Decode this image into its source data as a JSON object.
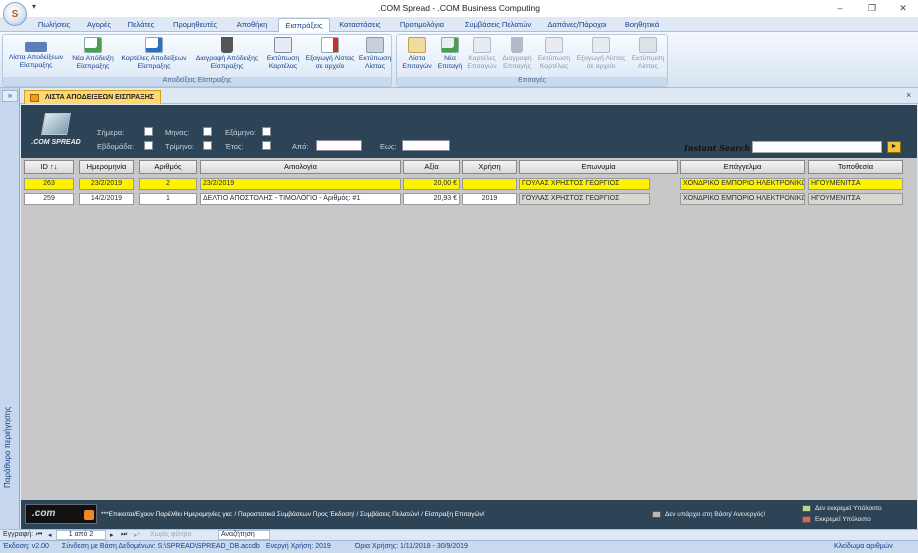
{
  "window": {
    "title": ".COM Spread - .COM Business Computing",
    "minimize": "–",
    "maximize": "❐",
    "close": "✕",
    "orb": "S",
    "qat": "▾"
  },
  "ribbon_tabs": [
    {
      "label": "Πωλήσεις"
    },
    {
      "label": "Αγορές"
    },
    {
      "label": "Πελάτες"
    },
    {
      "label": "Προμηθευτές"
    },
    {
      "label": "Αποθήκη"
    },
    {
      "label": "Εισπράξεις",
      "active": true
    },
    {
      "label": "Καταστάσεις"
    },
    {
      "label": "Προτιμολόγια"
    },
    {
      "label": "Συμβάσεις Πελατών"
    },
    {
      "label": "Δαπάνες/Πάροχοι"
    },
    {
      "label": "Βοηθητικά"
    }
  ],
  "ribbon_groups": [
    {
      "caption": "Αποδείξεις Είσπραξης",
      "buttons": [
        {
          "line1": "Λίστα Αποδείξεων",
          "line2": "Είσπραξης",
          "icon": "list-icon",
          "color": "#5b7fb8"
        },
        {
          "line1": "Νέα Απόδειξη",
          "line2": "Είσπραξης",
          "icon": "new-document-icon",
          "color": "#4aa04a"
        },
        {
          "line1": "Καρτέλες Αποδείξεων",
          "line2": "Είσπραξης",
          "icon": "info-card-icon",
          "color": "#2a70c8"
        },
        {
          "line1": "Διαγραφή Απόδειξης",
          "line2": "Είσπραξης",
          "icon": "trash-icon",
          "color": "#555555"
        },
        {
          "line1": "Εκτύπωση",
          "line2": "Καρτέλας",
          "icon": "print-preview-icon",
          "color": "#7a8aa0"
        },
        {
          "line1": "Εξαγωγή Λίστας",
          "line2": "σε αρχείο",
          "icon": "export-icon",
          "color": "#c83030"
        },
        {
          "line1": "Εκτύπωση",
          "line2": "Λίστας",
          "icon": "printer-icon",
          "color": "#8898ac"
        }
      ]
    },
    {
      "caption": "Επιταγές",
      "buttons": [
        {
          "line1": "Λίστα",
          "line2": "Επιταγών",
          "icon": "cheque-list-icon",
          "color": "#c8a040"
        },
        {
          "line1": "Νέα",
          "line2": "Επιταγή",
          "icon": "new-cheque-icon",
          "color": "#4aa04a"
        },
        {
          "line1": "Καρτέλες",
          "line2": "Επιταγών",
          "icon": "info-card-icon",
          "color": "#b0bccb",
          "disabled": true
        },
        {
          "line1": "Διαγραφή",
          "line2": "Επιταγής",
          "icon": "trash-icon",
          "color": "#b0bccb",
          "disabled": true
        },
        {
          "line1": "Εκτύπωση",
          "line2": "Καρτέλας",
          "icon": "print-preview-icon",
          "color": "#b0bccb",
          "disabled": true
        },
        {
          "line1": "Εξαγωγή Λίστας",
          "line2": "σε αρχείο",
          "icon": "export-icon",
          "color": "#b0bccb",
          "disabled": true
        },
        {
          "line1": "Εκτύπωση",
          "line2": "Λίστας",
          "icon": "printer-icon",
          "color": "#b0bccb",
          "disabled": true
        }
      ]
    }
  ],
  "nav_pane": {
    "toggle": "»",
    "label": "Παράθυρο περιήγησης"
  },
  "doc_tab": {
    "label": "ΛΙΣΤΑ ΑΠΟΔΕΙΞΕΩΝ ΕΙΣΠΡΑΞΗΣ",
    "close": "×"
  },
  "header": {
    "logo_text": ".COM SPREAD",
    "filters": {
      "today": "Σήμερα:",
      "week": "Εβδομάδα:",
      "month": "Μηνας:",
      "quarter": "Τρίμηνο:",
      "semester": "Εξάμηνο:",
      "year": "Έτος:",
      "from": "Από:",
      "to": "Εως:"
    },
    "instant_search_label": "Instant Search",
    "search_value": "",
    "search_go": "►"
  },
  "table": {
    "columns": [
      "ID ↑↓",
      "Ημερομηνία",
      "Αριθμός",
      "Αιτιολογία",
      "Αξία",
      "Χρήση",
      "Επωνυμία",
      "Επάγγελμα",
      "Τοποθεσία"
    ],
    "rows": [
      {
        "id": "263",
        "date": "23/2/2019",
        "number": "2",
        "reason": "23/2/2019",
        "amount": "20,00 €",
        "year": "",
        "name": "ΓΟΥΛΑΣ ΧΡΗΣΤΟΣ ΓΕΩΡΓΙΟΣ",
        "profession": "ΧΟΝΔΡΙΚΟ ΕΜΠΟΡΙΟ ΗΛΕΚΤΡΟΝΙΚΩΝ",
        "location": "ΗΓΟΥΜΕΝΙΤΣΑ",
        "selected": true
      },
      {
        "id": "259",
        "date": "14/2/2019",
        "number": "1",
        "reason": "ΔΕΛΤΙΟ ΑΠΟΣΤΟΛΗΣ - ΤΙΜΟΛΟΓΙΟ - Αριθμός: #1",
        "amount": "20,93 €",
        "year": "2019",
        "name": "ΓΟΥΛΑΣ ΧΡΗΣΤΟΣ ΓΕΩΡΓΙΟΣ",
        "profession": "ΧΟΝΔΡΙΚΟ ΕΜΠΟΡΙΟ ΗΛΕΚΤΡΟΝΙΚΩΝ",
        "location": "ΗΓΟΥΜΕΝΙΤΣΑ",
        "selected": false
      }
    ]
  },
  "footer": {
    "logo_text": ".com",
    "message": "***Επικειται/Εχουν Παρέλθει Ημερομηνίες για:  / Παραστατικά Συμβάσεων Προς Έκδοση! / Συμβάσεις Πελατών! / Είσπραξη Επιταγών!",
    "legend": [
      {
        "label": "Δεν υπάρχει στη Βάση/ Ανενεργός!",
        "color": "#b8b8b0"
      },
      {
        "label": "Δεν εκκρεμεί Υπόλοιπο",
        "color": "#b8d890"
      },
      {
        "label": "Εκκρεμεί Υπόλοιπο",
        "color": "#e06060"
      }
    ]
  },
  "record_nav": {
    "label": "Εγγραφή:",
    "first": "⏮",
    "prev": "◂",
    "position": "1 από 2",
    "next": "▸",
    "last": "⏭",
    "new": "▸*",
    "filter": "Χωρίς φίλτρο",
    "search": "Αναζήτηση"
  },
  "status": {
    "version": "Έκδοση: v2.00",
    "db": "Σύνδεση με Βάση Δεδομένων: S:\\SPREAD\\SPREAD_DB.accdb",
    "year": "Ενεργή Χρήση: 2019",
    "limit": "Όρια Χρήσης: 1/11/2018 - 30/9/2019",
    "numlock": "Κλείδωμα αριθμών"
  },
  "colors": {
    "accent": "#15428b",
    "header_bg": "#2d4456",
    "selected_row": "#fff200"
  }
}
